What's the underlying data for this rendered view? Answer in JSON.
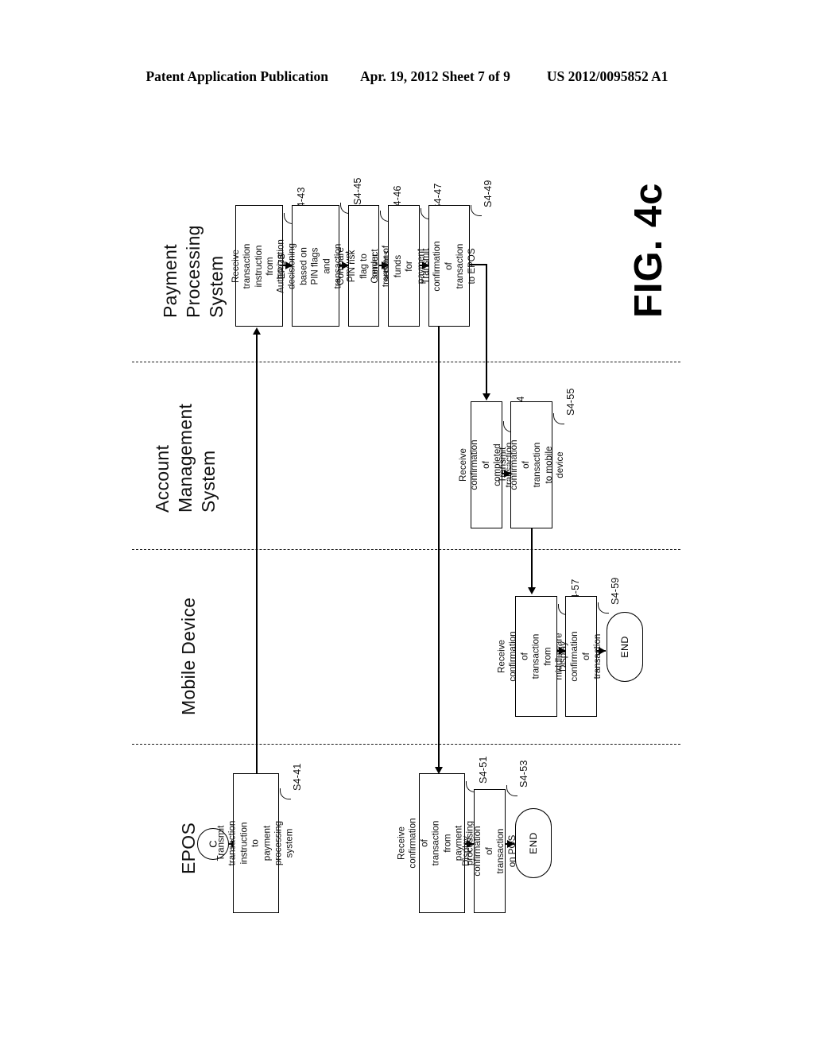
{
  "header": {
    "publication": "Patent Application Publication",
    "date_sheet": "Apr. 19, 2012  Sheet 7 of 9",
    "patent_number": "US 2012/0095852 A1"
  },
  "figure": {
    "caption": "FIG. 4c",
    "type": "swimlane-flowchart",
    "rotation_degrees": 90,
    "lanes": [
      {
        "id": "payment-processing-system",
        "label": "Payment\nProcessing\nSystem"
      },
      {
        "id": "account-management-system",
        "label": "Account\nManagement\nSystem"
      },
      {
        "id": "mobile-device",
        "label": "Mobile Device"
      },
      {
        "id": "epos",
        "label": "EPOS"
      }
    ],
    "connector": {
      "label": "C",
      "shape": "circle"
    },
    "nodes": [
      {
        "id": "s4-43",
        "lane": "payment-processing-system",
        "ref": "S4-43",
        "text": "Receive transaction\ninstruction from EPOS",
        "shape": "process"
      },
      {
        "id": "s4-45",
        "lane": "payment-processing-system",
        "ref": "S4-45",
        "text": "Authorization decisioning\nbased on PIN flags and\ntransaction amount",
        "shape": "process"
      },
      {
        "id": "s4-46",
        "lane": "payment-processing-system",
        "ref": "S4-46",
        "text": "Compare PIN risk flag to\nserver settings",
        "shape": "process"
      },
      {
        "id": "s4-47",
        "lane": "payment-processing-system",
        "ref": "S4-47",
        "text": "Conduct transfer of funds\nfor payment transaction",
        "shape": "process"
      },
      {
        "id": "s4-49",
        "lane": "payment-processing-system",
        "ref": "S4-49",
        "text": "Transmit confirmation of\ntransaction to EPOS",
        "shape": "process"
      },
      {
        "id": "s4-54",
        "lane": "account-management-system",
        "ref": "S4-54",
        "text": "Receive confirmation\nof completed transaction",
        "shape": "process"
      },
      {
        "id": "s4-55",
        "lane": "account-management-system",
        "ref": "S4-55",
        "text": "Transmit confirmation of\ntransaction to mobile\ndevice",
        "shape": "process"
      },
      {
        "id": "s4-57",
        "lane": "mobile-device",
        "ref": "S4-57",
        "text": "Receive confirmation of\ntransaction from\nmiddleware server",
        "shape": "process"
      },
      {
        "id": "s4-59",
        "lane": "mobile-device",
        "ref": "S4-59",
        "text": "Display confirmation of\ntransaction",
        "shape": "process"
      },
      {
        "id": "end-mobile",
        "lane": "mobile-device",
        "ref": "",
        "text": "END",
        "shape": "terminator"
      },
      {
        "id": "s4-41",
        "lane": "epos",
        "ref": "S4-41",
        "text": "Transmit transaction\ninstruction to payment\nprocessing system",
        "shape": "process"
      },
      {
        "id": "s4-51",
        "lane": "epos",
        "ref": "S4-51",
        "text": "Receive confirmation of\ntransaction from payment\nprocessing system",
        "shape": "process"
      },
      {
        "id": "s4-53",
        "lane": "epos",
        "ref": "S4-53",
        "text": "Display confirmation of\ntransaction on POS",
        "shape": "process"
      },
      {
        "id": "end-epos",
        "ref": "",
        "lane": "epos",
        "text": "END",
        "shape": "terminator"
      }
    ],
    "edges": [
      {
        "from": "connector-c",
        "to": "s4-41"
      },
      {
        "from": "s4-41",
        "to": "s4-43"
      },
      {
        "from": "s4-43",
        "to": "s4-45"
      },
      {
        "from": "s4-45",
        "to": "s4-46"
      },
      {
        "from": "s4-46",
        "to": "s4-47"
      },
      {
        "from": "s4-47",
        "to": "s4-49"
      },
      {
        "from": "s4-49",
        "to": "s4-54"
      },
      {
        "from": "s4-49",
        "to": "s4-51"
      },
      {
        "from": "s4-54",
        "to": "s4-55"
      },
      {
        "from": "s4-55",
        "to": "s4-57"
      },
      {
        "from": "s4-57",
        "to": "s4-59"
      },
      {
        "from": "s4-59",
        "to": "end-mobile"
      },
      {
        "from": "s4-51",
        "to": "s4-53"
      },
      {
        "from": "s4-53",
        "to": "end-epos"
      }
    ]
  }
}
